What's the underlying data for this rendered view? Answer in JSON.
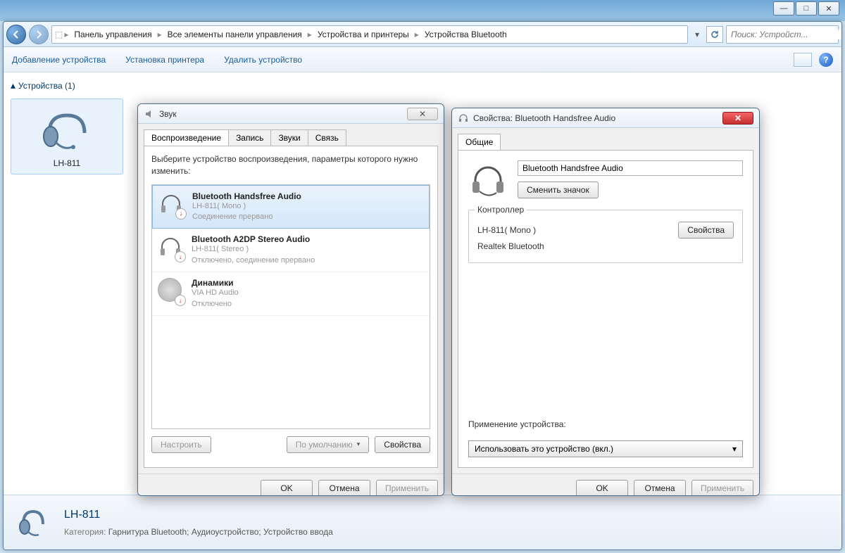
{
  "window_controls": {
    "min": "—",
    "max": "□",
    "close": "✕"
  },
  "breadcrumb": {
    "items": [
      "Панель управления",
      "Все элементы панели управления",
      "Устройства и принтеры",
      "Устройства Bluetooth"
    ]
  },
  "search": {
    "placeholder": "Поиск: Устройст..."
  },
  "toolbar": {
    "add_device": "Добавление устройства",
    "add_printer": "Установка принтера",
    "remove_device": "Удалить устройство"
  },
  "devices": {
    "header": "Устройства (1)",
    "item": "LH-811"
  },
  "sound_dialog": {
    "title": "Звук",
    "tabs": [
      "Воспроизведение",
      "Запись",
      "Звуки",
      "Связь"
    ],
    "instruction": "Выберите устройство воспроизведения, параметры которого нужно изменить:",
    "devices": [
      {
        "name": "Bluetooth Handsfree Audio",
        "sub1": "LH-811( Mono )",
        "sub2": "Соединение прервано"
      },
      {
        "name": "Bluetooth A2DP Stereo Audio",
        "sub1": "LH-811( Stereo )",
        "sub2": "Отключено, соединение прервано"
      },
      {
        "name": "Динамики",
        "sub1": "VIA HD Audio",
        "sub2": "Отключено"
      }
    ],
    "btn_configure": "Настроить",
    "btn_default": "По умолчанию",
    "btn_properties": "Свойства",
    "btn_ok": "OK",
    "btn_cancel": "Отмена",
    "btn_apply": "Применить"
  },
  "props_dialog": {
    "title": "Свойства: Bluetooth Handsfree Audio",
    "tab_general": "Общие",
    "device_name": "Bluetooth Handsfree Audio",
    "btn_change_icon": "Сменить значок",
    "controller_legend": "Контроллер",
    "controller_line1": "LH-811( Mono )",
    "controller_line2": "Realtek Bluetooth",
    "btn_ctrl_props": "Свойства",
    "usage_label": "Применение устройства:",
    "usage_value": "Использовать это устройство (вкл.)",
    "btn_ok": "OK",
    "btn_cancel": "Отмена",
    "btn_apply": "Применить"
  },
  "details": {
    "title": "LH-811",
    "category_label": "Категория:",
    "category_value": "Гарнитура Bluetooth; Аудиоустройство; Устройство ввода"
  }
}
